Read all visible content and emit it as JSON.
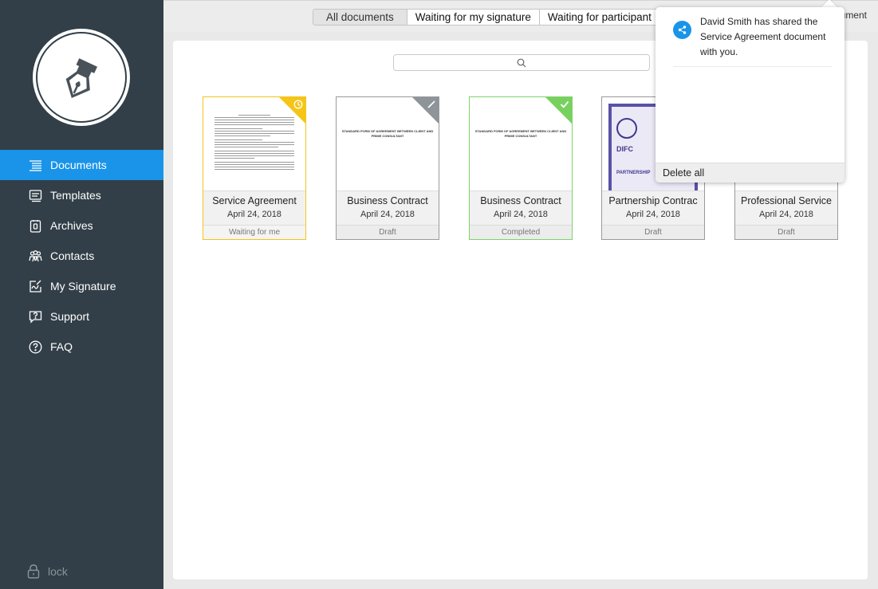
{
  "sidebar": {
    "items": [
      {
        "label": "Documents",
        "icon": "documents-icon",
        "active": true
      },
      {
        "label": "Templates",
        "icon": "templates-icon"
      },
      {
        "label": "Archives",
        "icon": "archives-icon"
      },
      {
        "label": "Contacts",
        "icon": "contacts-icon"
      },
      {
        "label": "My Signature",
        "icon": "signature-icon"
      },
      {
        "label": "Support",
        "icon": "support-icon"
      },
      {
        "label": "FAQ",
        "icon": "faq-icon"
      }
    ],
    "lock_label": "lock"
  },
  "tabs": {
    "all": "All documents",
    "waiting_mine": "Waiting for my signature",
    "waiting_participants": "Waiting for participant",
    "add_document": "ument"
  },
  "documents": [
    {
      "title": "Service Agreement",
      "date": "April 24, 2018",
      "status": "Waiting for me"
    },
    {
      "title": "Business Contract",
      "date": "April 24, 2018",
      "status": "Draft"
    },
    {
      "title": "Business Contract",
      "date": "April 24, 2018",
      "status": "Completed"
    },
    {
      "title": "Partnership Contrac",
      "date": "April 24, 2018",
      "status": "Draft"
    },
    {
      "title": "Professional Service",
      "date": "April 24, 2018",
      "status": "Draft"
    }
  ],
  "thumbnails": {
    "agreement_head": "STANDARD FORM OF AGREEMENT BETWEEN CLIENT AND PRIME CONSULTANT",
    "cert_brand": "DIFC",
    "cert_footer": "PARTNERSHIP"
  },
  "notification": {
    "message": "David Smith has shared the Service Agreement document with you.",
    "delete_all": "Delete all"
  },
  "colors": {
    "sidebar": "#323f48",
    "accent": "#1994e8",
    "waiting": "#f5c518",
    "completed": "#78d15f",
    "draft": "#8d949a"
  }
}
